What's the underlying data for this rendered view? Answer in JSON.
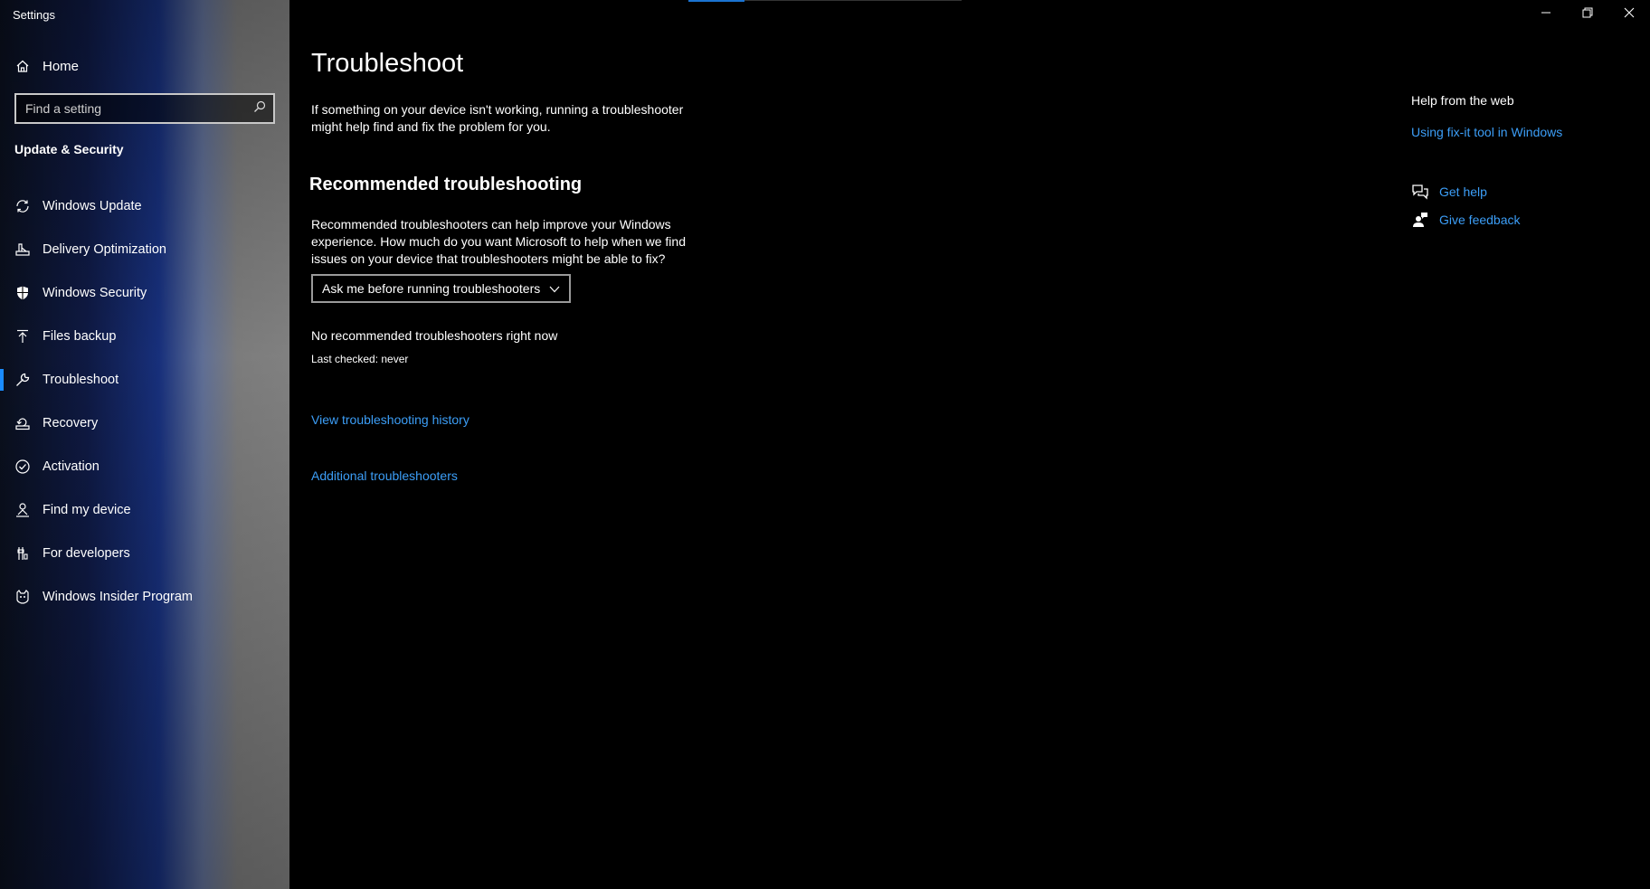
{
  "window": {
    "title": "Settings",
    "controls": {
      "minimize": "minimize-icon",
      "restore": "restore-icon",
      "close": "close-icon"
    }
  },
  "sidebar": {
    "home_label": "Home",
    "search_placeholder": "Find a setting",
    "section_label": "Update & Security",
    "active_color": "#1a8cff",
    "items": [
      {
        "label": "Windows Update",
        "icon": "sync-icon"
      },
      {
        "label": "Delivery Optimization",
        "icon": "delivery-icon"
      },
      {
        "label": "Windows Security",
        "icon": "shield-icon"
      },
      {
        "label": "Files backup",
        "icon": "upload-icon"
      },
      {
        "label": "Troubleshoot",
        "icon": "wrench-icon",
        "active": true
      },
      {
        "label": "Recovery",
        "icon": "recovery-icon"
      },
      {
        "label": "Activation",
        "icon": "check-circle-icon"
      },
      {
        "label": "Find my device",
        "icon": "person-pin-icon"
      },
      {
        "label": "For developers",
        "icon": "developer-icon"
      },
      {
        "label": "Windows Insider Program",
        "icon": "insider-icon"
      }
    ]
  },
  "main": {
    "title": "Troubleshoot",
    "intro": "If something on your device isn't working, running a troubleshooter might help find and fix the problem for you.",
    "recommended_heading": "Recommended troubleshooting",
    "recommended_desc": "Recommended troubleshooters can help improve your Windows experience. How much do you want Microsoft to help when we find issues on your device that troubleshooters might be able to fix?",
    "dropdown_value": "Ask me before running troubleshooters",
    "status": "No recommended troubleshooters right now",
    "last_checked": "Last checked: never",
    "history_link": "View troubleshooting history",
    "additional_link": "Additional troubleshooters",
    "link_color": "#3c9ef7"
  },
  "help": {
    "heading": "Help from the web",
    "fixit_link": "Using fix-it tool in Windows",
    "get_help": "Get help",
    "give_feedback": "Give feedback"
  }
}
